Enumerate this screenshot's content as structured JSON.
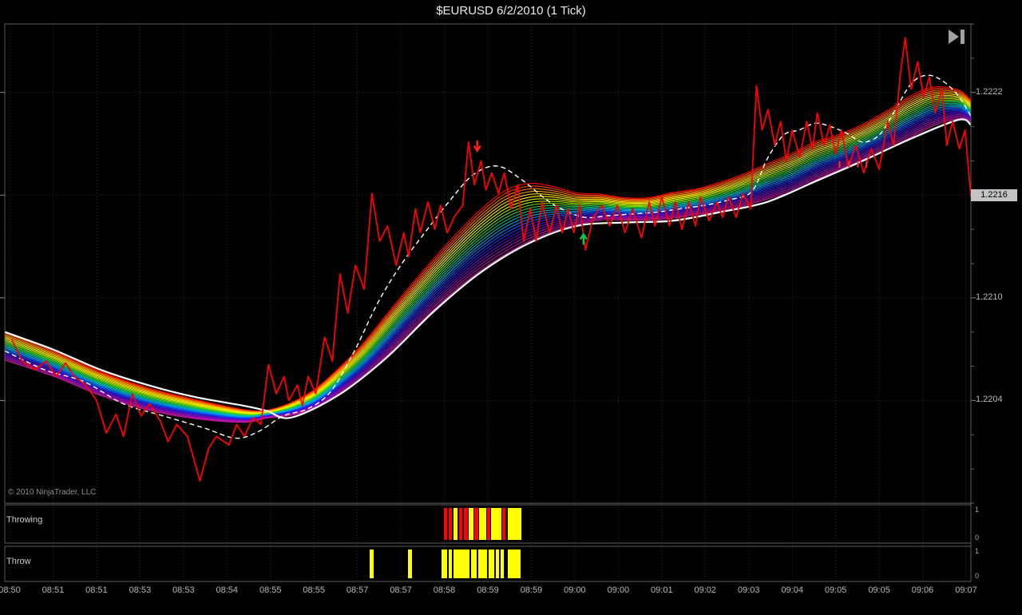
{
  "window": {
    "title": "$EURUSD  6/2/2010 (1 Tick)"
  },
  "chart_data": {
    "type": "line",
    "title": "$EURUSD 6/2/2010 (1 Tick)",
    "symbol": "$EURUSD",
    "date": "6/2/2010",
    "period": "1 Tick",
    "copyright": "© 2010 NinjaTrader, LLC",
    "x_axis": {
      "labels": [
        "08:50",
        "08:51",
        "08:51",
        "08:53",
        "08:53",
        "08:54",
        "08:55",
        "08:55",
        "08:57",
        "08:57",
        "08:58",
        "08:59",
        "08:59",
        "09:00",
        "09:00",
        "09:01",
        "09:02",
        "09:03",
        "09:04",
        "09:05",
        "09:05",
        "09:06",
        "09:07"
      ]
    },
    "y_axis": {
      "labels": [
        "1.2222",
        "1.2216",
        "1.2210",
        "1.2204"
      ],
      "range": [
        1.2198,
        1.2226
      ],
      "last_price": "1.2216"
    },
    "series": [
      {
        "name": "tick-price",
        "color": "#ff0000",
        "style": "solid",
        "x": [
          0.007,
          0.018,
          0.031,
          0.043,
          0.053,
          0.063,
          0.072,
          0.084,
          0.095,
          0.105,
          0.115,
          0.123,
          0.132,
          0.141,
          0.15,
          0.161,
          0.169,
          0.178,
          0.189,
          0.202,
          0.211,
          0.219,
          0.232,
          0.24,
          0.248,
          0.257,
          0.265,
          0.273,
          0.281,
          0.289,
          0.294,
          0.303,
          0.308,
          0.314,
          0.322,
          0.331,
          0.339,
          0.347,
          0.355,
          0.363,
          0.372,
          0.38,
          0.388,
          0.396,
          0.405,
          0.413,
          0.418,
          0.425,
          0.43,
          0.438,
          0.445,
          0.451,
          0.458,
          0.465,
          0.474,
          0.48,
          0.486,
          0.493,
          0.498,
          0.504,
          0.511,
          0.517,
          0.524,
          0.531,
          0.537,
          0.544,
          0.55,
          0.556,
          0.564,
          0.571,
          0.577,
          0.583,
          0.589,
          0.595,
          0.601,
          0.609,
          0.618,
          0.626,
          0.634,
          0.642,
          0.65,
          0.659,
          0.667,
          0.673,
          0.68,
          0.688,
          0.694,
          0.701,
          0.708,
          0.715,
          0.72,
          0.729,
          0.737,
          0.743,
          0.749,
          0.757,
          0.764,
          0.772,
          0.778,
          0.784,
          0.79,
          0.797,
          0.803,
          0.809,
          0.815,
          0.823,
          0.83,
          0.836,
          0.841,
          0.848,
          0.854,
          0.86,
          0.866,
          0.873,
          0.881,
          0.889,
          0.897,
          0.905,
          0.914,
          0.92,
          0.927,
          0.932,
          0.938,
          0.945,
          0.951,
          0.957,
          0.963,
          0.97,
          0.975,
          0.981,
          0.988,
          0.994,
          1.0
        ],
        "price": [
          1.22076,
          1.22063,
          1.22058,
          1.22063,
          1.22054,
          1.22062,
          1.22054,
          1.22049,
          1.2204,
          1.22021,
          1.22032,
          1.22019,
          1.22044,
          1.22031,
          1.22038,
          1.22028,
          1.22016,
          1.22026,
          1.22019,
          1.21993,
          1.22012,
          1.22019,
          1.22014,
          1.22026,
          1.22019,
          1.2203,
          1.22026,
          1.22061,
          1.22044,
          1.22054,
          1.2204,
          1.22049,
          1.22037,
          1.22054,
          1.22044,
          1.22077,
          1.22063,
          1.22114,
          1.22091,
          1.22119,
          1.22105,
          1.22161,
          1.22133,
          1.22142,
          1.22119,
          1.22138,
          1.22124,
          1.22152,
          1.22138,
          1.22156,
          1.2214,
          1.22154,
          1.22138,
          1.22147,
          1.22154,
          1.22191,
          1.22166,
          1.2218,
          1.22163,
          1.22173,
          1.22161,
          1.22173,
          1.22152,
          1.22166,
          1.22133,
          1.22152,
          1.22133,
          1.22156,
          1.22138,
          1.22154,
          1.22138,
          1.22152,
          1.22138,
          1.22154,
          1.22128,
          1.22147,
          1.22154,
          1.22142,
          1.22154,
          1.22138,
          1.22152,
          1.22135,
          1.22156,
          1.22142,
          1.22159,
          1.22142,
          1.22156,
          1.2214,
          1.22156,
          1.22142,
          1.22159,
          1.22145,
          1.22156,
          1.22147,
          1.22159,
          1.22147,
          1.22161,
          1.22152,
          1.22224,
          1.22198,
          1.2221,
          1.22189,
          1.22203,
          1.2218,
          1.22198,
          1.22182,
          1.22203,
          1.22187,
          1.22208,
          1.22189,
          1.22201,
          1.22184,
          1.22198,
          1.22177,
          1.22189,
          1.22173,
          1.22187,
          1.22175,
          1.22203,
          1.22189,
          1.22231,
          1.22252,
          1.22222,
          1.22238,
          1.22217,
          1.22229,
          1.22208,
          1.22222,
          1.22189,
          1.22203,
          1.22187,
          1.22198,
          1.22159
        ]
      },
      {
        "name": "fast-ma",
        "color": "#ffffff",
        "style": "dashed",
        "x": [
          0,
          0.041,
          0.082,
          0.123,
          0.164,
          0.206,
          0.239,
          0.263,
          0.288,
          0.313,
          0.337,
          0.362,
          0.386,
          0.411,
          0.436,
          0.461,
          0.485,
          0.51,
          0.535,
          0.559,
          0.576,
          0.6,
          0.625,
          0.65,
          0.674,
          0.699,
          0.724,
          0.748,
          0.773,
          0.789,
          0.806,
          0.822,
          0.839,
          0.855,
          0.872,
          0.888,
          0.905,
          0.921,
          0.938,
          0.954,
          0.97,
          0.987,
          1.0
        ],
        "price": [
          1.22069,
          1.22058,
          1.22051,
          1.22038,
          1.22031,
          1.22024,
          1.22018,
          1.22022,
          1.22031,
          1.22035,
          1.22045,
          1.22069,
          1.22097,
          1.2212,
          1.22139,
          1.22157,
          1.22172,
          1.22177,
          1.22169,
          1.22158,
          1.22152,
          1.22147,
          1.22148,
          1.22149,
          1.2215,
          1.22152,
          1.22154,
          1.22157,
          1.22162,
          1.22181,
          1.22195,
          1.22198,
          1.22202,
          1.222,
          1.22196,
          1.22191,
          1.22195,
          1.22209,
          1.22225,
          1.2223,
          1.22227,
          1.22218,
          1.22206
        ]
      },
      {
        "name": "envelope-ma",
        "color": "#ffffff",
        "style": "solid",
        "x": [
          0,
          0.049,
          0.099,
          0.148,
          0.197,
          0.247,
          0.271,
          0.296,
          0.345,
          0.395,
          0.444,
          0.493,
          0.543,
          0.592,
          0.641,
          0.691,
          0.74,
          0.789,
          0.839,
          0.888,
          0.938,
          0.987,
          1.0
        ],
        "price": [
          1.2208,
          1.2207,
          1.22058,
          1.22049,
          1.22042,
          1.22037,
          1.22034,
          1.2203,
          1.22043,
          1.22065,
          1.22092,
          1.22115,
          1.22132,
          1.22142,
          1.22144,
          1.22145,
          1.2215,
          1.22156,
          1.22168,
          1.2218,
          1.22193,
          1.22204,
          1.22201
        ]
      }
    ],
    "ribbon": {
      "name": "rainbow-ma-ribbon",
      "colors": [
        "#ff0000",
        "#ff4000",
        "#ff7300",
        "#ffa600",
        "#ffd000",
        "#fff200",
        "#d4f000",
        "#a8e800",
        "#70dc00",
        "#2ecc40",
        "#00c37a",
        "#00b8b8",
        "#00a8e8",
        "#0080ff",
        "#0055ff",
        "#2a2aee",
        "#3c14d2",
        "#5a10c8",
        "#7a10c0",
        "#9a10b8",
        "#b810b0",
        "#d018a8"
      ],
      "x": [
        0,
        0.049,
        0.099,
        0.148,
        0.197,
        0.247,
        0.271,
        0.296,
        0.321,
        0.345,
        0.37,
        0.395,
        0.419,
        0.444,
        0.469,
        0.493,
        0.518,
        0.543,
        0.567,
        0.592,
        0.617,
        0.641,
        0.666,
        0.691,
        0.715,
        0.74,
        0.765,
        0.789,
        0.814,
        0.839,
        0.863,
        0.888,
        0.913,
        0.938,
        0.962,
        0.987,
        1.0
      ],
      "center": [
        1.22072,
        1.22062,
        1.2205,
        1.22041,
        1.22035,
        1.22031,
        1.22032,
        1.22035,
        1.22041,
        1.22051,
        1.22063,
        1.22078,
        1.22093,
        1.22108,
        1.22122,
        1.22134,
        1.22144,
        1.2215,
        1.22152,
        1.22152,
        1.22153,
        1.22152,
        1.22152,
        1.22154,
        1.22156,
        1.22159,
        1.22163,
        1.22168,
        1.22173,
        1.2218,
        1.22185,
        1.22191,
        1.22198,
        1.22206,
        1.22212,
        1.22213,
        1.22209
      ],
      "spread_micro": [
        84,
        75,
        70,
        65,
        56,
        37,
        23,
        37,
        56,
        75,
        98,
        121,
        135,
        149,
        163,
        177,
        187,
        168,
        131,
        93,
        75,
        65,
        65,
        75,
        75,
        84,
        93,
        103,
        112,
        112,
        103,
        103,
        112,
        121,
        112,
        84,
        65
      ]
    },
    "markers": [
      {
        "type": "arrow-down",
        "x": 0.489,
        "price": 1.22185,
        "color": "#ff2020"
      },
      {
        "type": "arrow-up",
        "x": 0.599,
        "price": 1.22138,
        "color": "#00cc44"
      },
      {
        "type": "tick",
        "x": 0.864,
        "price": 1.22178,
        "color": "#ff3030"
      },
      {
        "type": "tick",
        "x": 0.874,
        "price": 1.22178,
        "color": "#ff3030"
      },
      {
        "type": "tick",
        "x": 0.883,
        "price": 1.22178,
        "color": "#ff3030"
      },
      {
        "type": "tick",
        "x": 0.892,
        "price": 1.22178,
        "color": "#ff3030"
      }
    ],
    "panels": [
      {
        "label": "Throwing",
        "scale_top": "1",
        "scale_bottom": "0",
        "bars": [
          {
            "x": 556,
            "w": 4,
            "color": "#ff0000"
          },
          {
            "x": 562,
            "w": 4,
            "color": "#ff0000"
          },
          {
            "x": 568,
            "w": 5,
            "color": "#ffff00"
          },
          {
            "x": 575,
            "w": 4,
            "color": "#ff0000"
          },
          {
            "x": 581,
            "w": 5,
            "color": "#ff0000"
          },
          {
            "x": 587,
            "w": 6,
            "color": "#ffff00"
          },
          {
            "x": 594,
            "w": 5,
            "color": "#ff0000"
          },
          {
            "x": 600,
            "w": 9,
            "color": "#ffff00"
          },
          {
            "x": 610,
            "w": 4,
            "color": "#ff0000"
          },
          {
            "x": 615,
            "w": 13,
            "color": "#ffff00"
          },
          {
            "x": 629,
            "w": 4,
            "color": "#ff0000"
          },
          {
            "x": 636,
            "w": 17,
            "color": "#ffff00"
          }
        ]
      },
      {
        "label": "Throw",
        "scale_top": "1",
        "scale_bottom": "0",
        "bars": [
          {
            "x": 463,
            "w": 5,
            "color": "#ffff00"
          },
          {
            "x": 511,
            "w": 5,
            "color": "#ffff00"
          },
          {
            "x": 553,
            "w": 7,
            "color": "#ffff00"
          },
          {
            "x": 562,
            "w": 4,
            "color": "#ffff00"
          },
          {
            "x": 568,
            "w": 20,
            "color": "#ffff00"
          },
          {
            "x": 590,
            "w": 7,
            "color": "#ffff00"
          },
          {
            "x": 599,
            "w": 11,
            "color": "#ffff00"
          },
          {
            "x": 612,
            "w": 7,
            "color": "#ffff00"
          },
          {
            "x": 621,
            "w": 4,
            "color": "#ffff00"
          },
          {
            "x": 627,
            "w": 4,
            "color": "#ffff00"
          },
          {
            "x": 636,
            "w": 16,
            "color": "#ffff00"
          }
        ]
      }
    ]
  }
}
